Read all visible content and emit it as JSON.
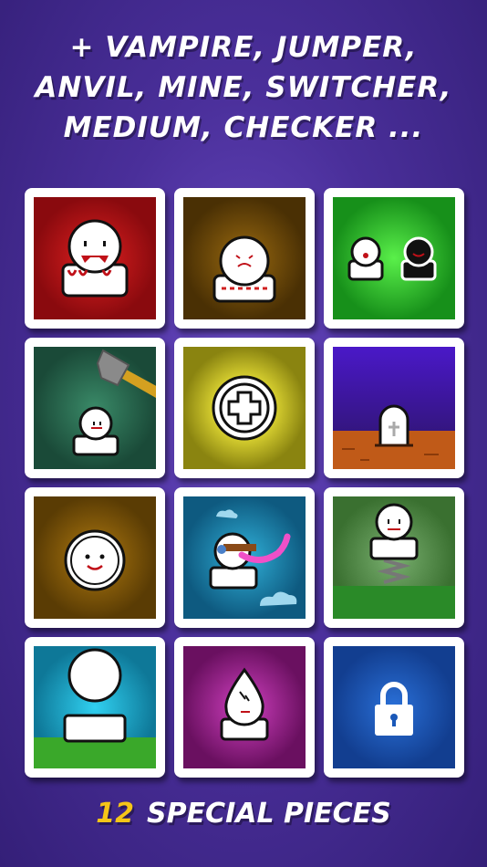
{
  "headline": {
    "line1": "+ VAMPIRE, JUMPER,",
    "line2": "ANVIL, MINE, SWITCHER,",
    "line3": "MEDIUM, CHECKER ..."
  },
  "pieces": [
    {
      "name": "vampire",
      "bg": "#c0141a"
    },
    {
      "name": "anvil",
      "bg": "#7a4f0a"
    },
    {
      "name": "switcher",
      "bg": "#2ec92a"
    },
    {
      "name": "hammer",
      "bg": "#2a6a50"
    },
    {
      "name": "medic",
      "bg": "#c8c020"
    },
    {
      "name": "grave",
      "bg": "#3a22a8"
    },
    {
      "name": "coin",
      "bg": "#8a5a08"
    },
    {
      "name": "tongue",
      "bg": "#1a8fc0"
    },
    {
      "name": "jumper",
      "bg": "#5aa048"
    },
    {
      "name": "giant",
      "bg": "#1aa8c8"
    },
    {
      "name": "flame",
      "bg": "#a02898"
    },
    {
      "name": "locked",
      "bg": "#1a58b8"
    }
  ],
  "footer": {
    "count": "12",
    "label": "SPECIAL PIECES"
  }
}
